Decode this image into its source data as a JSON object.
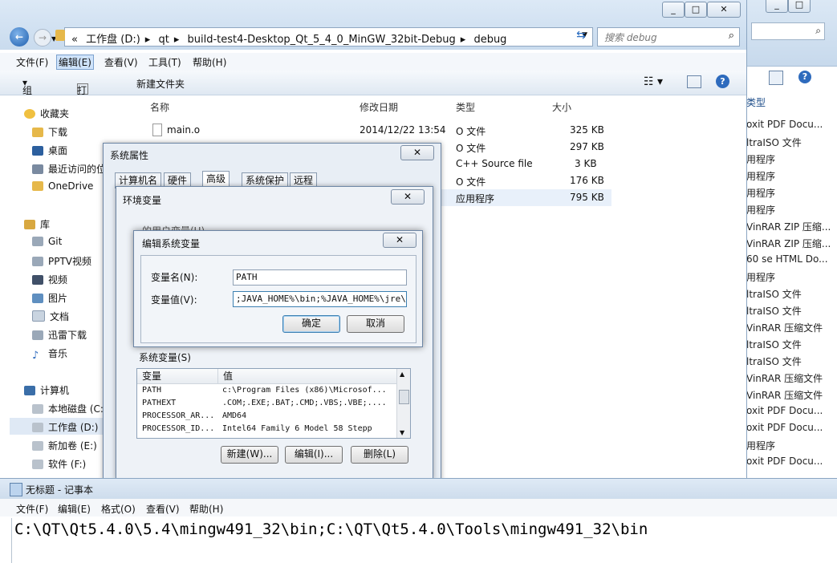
{
  "explorer": {
    "address_crumbs": [
      "«",
      "工作盘 (D:)",
      "qt",
      "build-test4-Desktop_Qt_5_4_0_MinGW_32bit-Debug",
      "debug"
    ],
    "search_placeholder": "搜索 debug",
    "menu": [
      "文件(F)",
      "编辑(E)",
      "查看(V)",
      "工具(T)",
      "帮助(H)"
    ],
    "toolbar": {
      "organize": "组织",
      "open": "打开",
      "new_folder": "新建文件夹"
    },
    "nav": {
      "favorites": "收藏夹",
      "favorites_items": [
        "下载",
        "桌面",
        "最近访问的位置",
        "OneDrive"
      ],
      "libraries": "库",
      "library_items": [
        "Git",
        "PPTV视频",
        "视频",
        "图片",
        "文档",
        "迅雷下载",
        "音乐"
      ],
      "computer": "计算机",
      "computer_items": [
        "本地磁盘 (C:)",
        "工作盘 (D:)",
        "新加卷 (E:)",
        "软件 (F:)"
      ]
    },
    "columns": [
      "名称",
      "修改日期",
      "类型",
      "大小"
    ],
    "files": [
      {
        "name": "main.o",
        "date": "2014/12/22 13:54",
        "type": "O 文件",
        "size": "325 KB"
      },
      {
        "name": "",
        "date": "",
        "type": "O 文件",
        "size": "297 KB"
      },
      {
        "name": "",
        "date": "",
        "type": "C++ Source file",
        "size": "3 KB"
      },
      {
        "name": "",
        "date": "",
        "type": "O 文件",
        "size": "176 KB"
      },
      {
        "name": "",
        "date": "",
        "type": "应用程序",
        "size": "795 KB"
      }
    ]
  },
  "bg_window": {
    "type_header": "类型",
    "types": [
      "oxit PDF Docu...",
      "ltraISO 文件",
      "用程序",
      "用程序",
      "用程序",
      "用程序",
      "VinRAR ZIP 压缩...",
      "VinRAR ZIP 压缩...",
      "60 se HTML Do...",
      "用程序",
      "ltraISO 文件",
      "ltraISO 文件",
      "VinRAR 压缩文件",
      "ltraISO 文件",
      "ltraISO 文件",
      "VinRAR 压缩文件",
      "VinRAR 压缩文件",
      "oxit PDF Docu...",
      "oxit PDF Docu...",
      "用程序",
      "oxit PDF Docu..."
    ]
  },
  "sysprop": {
    "title": "系统属性",
    "tabs": [
      "计算机名",
      "硬件",
      "高级",
      "系统保护",
      "远程"
    ]
  },
  "envvar": {
    "title": "环境变量",
    "user_vars_label": "的用户变量(U)",
    "sys_vars_label": "系统变量(S)",
    "col_var": "变量",
    "col_val": "值",
    "rows": [
      {
        "name": "PATH",
        "value": "c:\\Program Files (x86)\\Microsof..."
      },
      {
        "name": "PATHEXT",
        "value": ".COM;.EXE;.BAT;.CMD;.VBS;.VBE;...."
      },
      {
        "name": "PROCESSOR_AR...",
        "value": "AMD64"
      },
      {
        "name": "PROCESSOR_ID...",
        "value": "Intel64 Family 6 Model 58 Stepp"
      }
    ],
    "buttons": {
      "new": "新建(W)...",
      "edit": "编辑(I)...",
      "delete": "删除(L)"
    }
  },
  "editvar": {
    "title": "编辑系统变量",
    "name_label": "变量名(N):",
    "name_value": "PATH",
    "value_label": "变量值(V):",
    "value_value": ";JAVA_HOME%\\bin;%JAVA_HOME%\\jre\\bin;",
    "ok": "确定",
    "cancel": "取消"
  },
  "notepad": {
    "title": "无标题 - 记事本",
    "menu": [
      "文件(F)",
      "编辑(E)",
      "格式(O)",
      "查看(V)",
      "帮助(H)"
    ],
    "text": "C:\\QT\\Qt5.4.0\\5.4\\mingw491_32\\bin;C:\\QT\\Qt5.4.0\\Tools\\mingw491_32\\bin"
  },
  "colors": {
    "accent": "#3c7fb1",
    "selection": "#cfe3fa",
    "titlebar": "#cddcec"
  }
}
